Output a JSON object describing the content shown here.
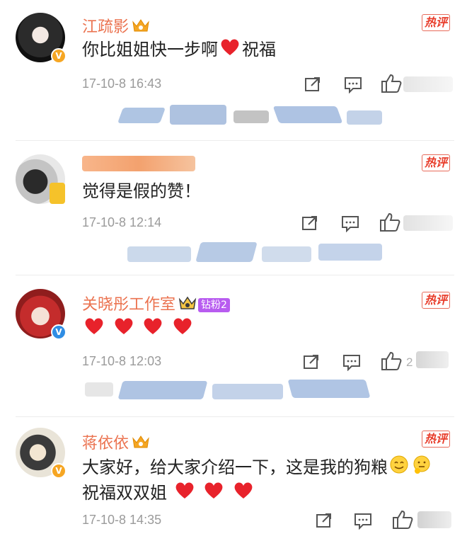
{
  "comments": [
    {
      "username": "江疏影",
      "text": "你比姐姐快一步啊",
      "text_after_heart": "祝福",
      "time": "17-10-8 16:43",
      "like_count": "",
      "hot_label": "热评"
    },
    {
      "username": "",
      "text": "觉得是假的赞！",
      "time": "17-10-8 12:14",
      "like_count": "",
      "hot_label": "热评"
    },
    {
      "username": "关晓彤工作室",
      "fan_badge": "钻粉2",
      "text": "",
      "time": "17-10-8 12:03",
      "like_count": "2",
      "hot_label": "热评"
    },
    {
      "username": "蒋依依",
      "text_line1": "大家好，给大家介绍一下，这是我的狗粮",
      "text_line2": "祝福双双姐",
      "time": "17-10-8 14:35",
      "like_count": "",
      "hot_label": "热评"
    }
  ],
  "icons": [
    "share-icon",
    "comment-icon",
    "like-icon",
    "crown-icon",
    "heart-icon",
    "verified-badge-icon"
  ],
  "colors": {
    "username": "#eb7350",
    "hot_border": "#e86b5a",
    "fan_badge": "#b85cf0",
    "heart": "#e8222b",
    "verified_gold": "#f6a623",
    "verified_blue": "#2f8de4"
  }
}
